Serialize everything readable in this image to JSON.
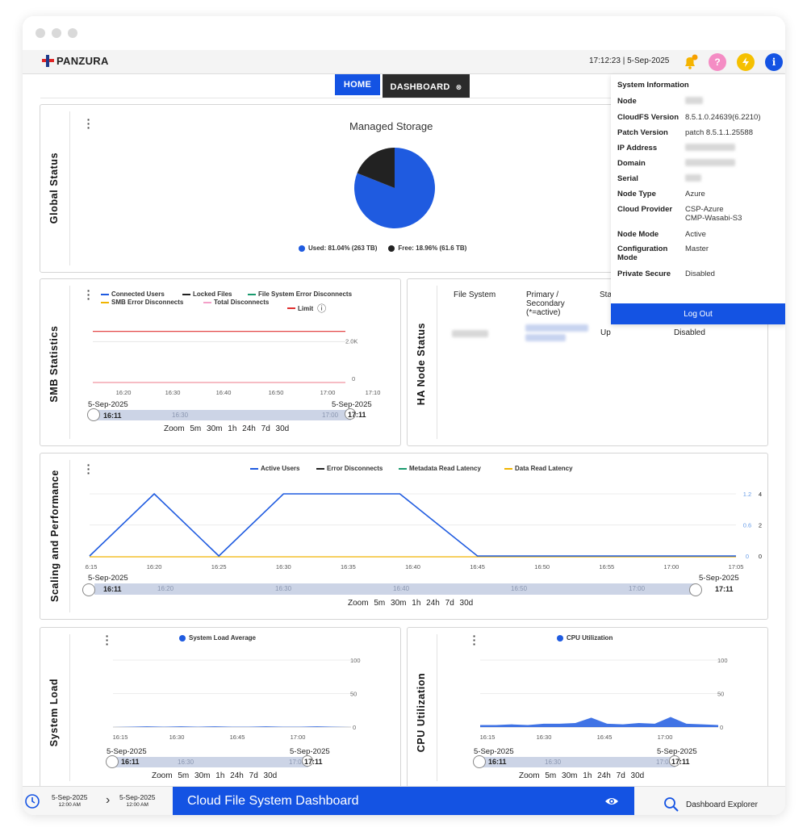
{
  "app": {
    "logo_text": "PANZURA",
    "datetime": "17:12:23 | 5-Sep-2025"
  },
  "nav": {
    "home": "HOME",
    "dashboard": "DASHBOARD",
    "dashboard_close": "⊗"
  },
  "topicons": {
    "help": "?",
    "info": "i"
  },
  "global_status": {
    "title": "Global Status",
    "chart_data": {
      "type": "pie",
      "title": "Managed Storage",
      "slices": [
        {
          "label": "Used: 81.04% (263 TB)",
          "value": 81.04,
          "color": "#1f5be0"
        },
        {
          "label": "Free: 18.96% (61.6 TB)",
          "value": 18.96,
          "color": "#222222"
        }
      ]
    }
  },
  "smb": {
    "title": "SMB Statistics",
    "legend": [
      {
        "name": "Connected Users",
        "color": "#1f5be0"
      },
      {
        "name": "Locked Files",
        "color": "#222222"
      },
      {
        "name": "File System Error Disconnects",
        "color": "#1a9a6e"
      },
      {
        "name": "SMB Error Disconnects",
        "color": "#f0b400"
      },
      {
        "name": "Total Disconnects",
        "color": "#f4a0c8"
      },
      {
        "name": "Limit",
        "color": "#e03030"
      }
    ],
    "limit_info_icon": "ⓘ",
    "chart_data": {
      "type": "line",
      "x_ticks": [
        "16:20",
        "16:30",
        "16:40",
        "16:50",
        "17:00",
        "17:10"
      ],
      "y_ticks": [
        "2.0K",
        "0"
      ],
      "ylim": [
        0,
        3000
      ],
      "series": [
        {
          "name": "Limit",
          "color": "#e03030",
          "values": [
            2500,
            2500
          ]
        },
        {
          "name": "SMB Error Disconnects",
          "color": "#f0b400",
          "values": [
            0,
            0
          ]
        },
        {
          "name": "Total Disconnects",
          "color": "#f4a0c8",
          "values": [
            0,
            0
          ]
        }
      ]
    },
    "range_start_date": "5-Sep-2025",
    "range_end_date": "5-Sep-2025",
    "range_start_time": "16:11",
    "range_end_time": "17:11",
    "range_mid1": "16:30",
    "range_mid2": "17:00",
    "zoom": [
      "Zoom",
      "5m",
      "30m",
      "1h",
      "24h",
      "7d",
      "30d"
    ]
  },
  "ha": {
    "title": "HA Node Status",
    "headers": [
      "File System",
      "Primary / Secondary (*=active)",
      "Sta"
    ],
    "row": {
      "status": "Up",
      "extra": "Disabled"
    }
  },
  "scaling": {
    "title": "Scaling and Performance",
    "legend": [
      {
        "name": "Active Users",
        "color": "#1f5be0"
      },
      {
        "name": "Error Disconnects",
        "color": "#222222"
      },
      {
        "name": "Metadata Read Latency",
        "color": "#1a9a6e"
      },
      {
        "name": "Data Read Latency",
        "color": "#f0b400"
      }
    ],
    "chart_data": {
      "type": "line",
      "x_ticks": [
        "16:15",
        "16:20",
        "16:25",
        "16:30",
        "16:35",
        "16:40",
        "16:45",
        "16:50",
        "16:55",
        "17:00",
        "17:05"
      ],
      "series": [
        {
          "name": "Active Users",
          "color": "#1f5be0",
          "x": [
            "16:15",
            "16:20",
            "16:25",
            "16:30",
            "16:39",
            "16:45",
            "17:05"
          ],
          "values": [
            0,
            1,
            0,
            1,
            1,
            0,
            0
          ]
        }
      ],
      "y_axes": [
        {
          "color": "#6a9ee8",
          "ticks": [
            "1.2",
            "0.6",
            "0"
          ]
        },
        {
          "color": "#222222",
          "ticks": [
            "4",
            "2",
            "0"
          ]
        },
        {
          "color": "#33aa55",
          "ticks": [
            "4",
            "2",
            "0"
          ]
        },
        {
          "color": "#e08840",
          "ticks": [
            "4",
            "2",
            "0"
          ]
        }
      ]
    },
    "range_start_date": "5-Sep-2025",
    "range_end_date": "5-Sep-2025",
    "range_start_time": "16:11",
    "range_end_time": "17:11",
    "range_ticks": [
      "16:20",
      "16:30",
      "16:40",
      "16:50",
      "17:00"
    ],
    "zoom": [
      "Zoom",
      "5m",
      "30m",
      "1h",
      "24h",
      "7d",
      "30d"
    ]
  },
  "sysload": {
    "title": "System Load",
    "legend": "System Load Average",
    "chart_data": {
      "type": "area",
      "x_ticks": [
        "16:15",
        "16:30",
        "16:45",
        "17:00"
      ],
      "y_ticks": [
        "100",
        "50",
        "0"
      ],
      "ylim": [
        0,
        100
      ],
      "series": [
        {
          "name": "System Load Average",
          "color": "#1f5be0",
          "values": [
            0,
            0.5,
            1,
            0.5,
            1,
            0.5,
            1,
            0.5,
            0.5,
            1,
            0.5,
            0.5,
            1,
            0.5,
            0
          ]
        }
      ]
    },
    "range_start_date": "5-Sep-2025",
    "range_end_date": "5-Sep-2025",
    "range_start_time": "16:11",
    "range_end_time": "17:11",
    "range_mid1": "16:30",
    "range_mid2": "17:00",
    "zoom": [
      "Zoom",
      "5m",
      "30m",
      "1h",
      "24h",
      "7d",
      "30d"
    ]
  },
  "cpu": {
    "title": "CPU Utilization",
    "legend": "CPU Utilization",
    "chart_data": {
      "type": "area",
      "x_ticks": [
        "16:15",
        "16:30",
        "16:45",
        "17:00"
      ],
      "y_ticks": [
        "100",
        "50",
        "0"
      ],
      "ylim": [
        0,
        100
      ],
      "series": [
        {
          "name": "CPU Utilization",
          "color": "#1f5be0",
          "values": [
            3,
            3,
            4,
            3,
            5,
            5,
            6,
            14,
            5,
            4,
            6,
            5,
            15,
            5,
            4,
            3
          ]
        }
      ]
    },
    "range_start_date": "5-Sep-2025",
    "range_end_date": "5-Sep-2025",
    "range_start_time": "16:11",
    "range_end_time": "17:11",
    "range_mid1": "16:30",
    "range_mid2": "17:00",
    "zoom": [
      "Zoom",
      "5m",
      "30m",
      "1h",
      "24h",
      "7d",
      "30d"
    ]
  },
  "sysinfo": {
    "title": "System Information",
    "rows": [
      {
        "key": "Node",
        "value": ""
      },
      {
        "key": "CloudFS Version",
        "value": "8.5.1.0.24639(6.2210)"
      },
      {
        "key": "Patch Version",
        "value": "patch 8.5.1.1.25588"
      },
      {
        "key": "IP Address",
        "value": ""
      },
      {
        "key": "Domain",
        "value": ""
      },
      {
        "key": "Serial",
        "value": ""
      },
      {
        "key": "Node Type",
        "value": "Azure"
      },
      {
        "key": "Cloud Provider",
        "value": "CSP-Azure\nCMP-Wasabi-S3"
      },
      {
        "key": "Node Mode",
        "value": "Active"
      },
      {
        "key": "Configuration Mode",
        "value": "Master"
      },
      {
        "key": "Private Secure",
        "value": "Disabled"
      }
    ],
    "logout": "Log Out"
  },
  "footer": {
    "start_date": "5-Sep-2025",
    "start_time": "12:00 AM",
    "arrow": "›",
    "end_date": "5-Sep-2025",
    "end_time": "12:00 AM",
    "dashboard_name": "Cloud File System Dashboard",
    "explorer": "Dashboard Explorer"
  },
  "colors": {
    "accent": "#1453e3",
    "dark_tab": "#2b2b2b",
    "bell": "#f5b400",
    "help": "#f48cc4",
    "refresh": "#f5c000"
  }
}
